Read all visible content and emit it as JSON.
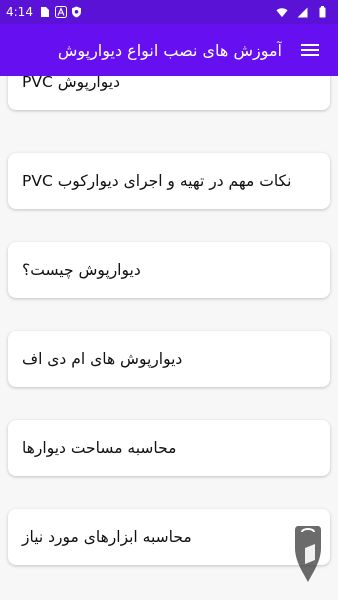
{
  "status_bar": {
    "time": "4:14",
    "left_icons": [
      "sim-card-icon",
      "a-notification-icon",
      "vpn-shield-icon"
    ],
    "right_icons": [
      "wifi-icon",
      "cell-signal-icon",
      "battery-icon"
    ]
  },
  "app_bar": {
    "title": "آموزش های نصب انواع دیوارپوش",
    "menu_icon": "hamburger-menu-icon"
  },
  "list": {
    "items": [
      {
        "label": "دیوارپوش PVC"
      },
      {
        "label": "نکات مهم در تهیه و اجرای دیوارکوب PVC"
      },
      {
        "label": "دیوارپوش چیست؟"
      },
      {
        "label": "دیوارپوش های ام دی اف"
      },
      {
        "label": "محاسبه مساحت دیوارها"
      },
      {
        "label": "محاسبه ابزارهای مورد نیاز"
      }
    ]
  },
  "colors": {
    "status_bar": "#5a12d6",
    "app_bar": "#6610f2",
    "background": "#f7f7f7",
    "card": "#ffffff"
  }
}
